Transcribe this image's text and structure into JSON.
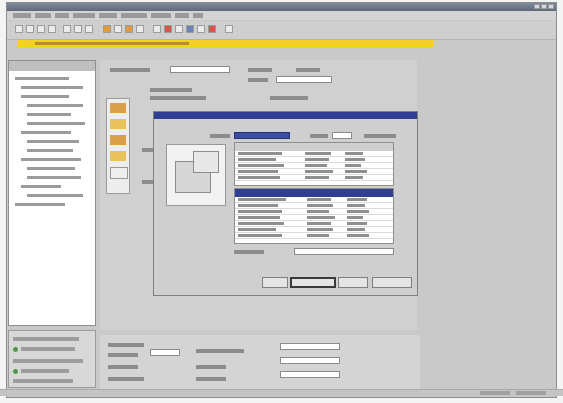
{
  "app": {
    "title": ""
  },
  "menu": [
    {
      "label": ""
    },
    {
      "label": ""
    },
    {
      "label": ""
    },
    {
      "label": ""
    },
    {
      "label": ""
    },
    {
      "label": ""
    },
    {
      "label": ""
    },
    {
      "label": ""
    },
    {
      "label": ""
    }
  ],
  "toolbar": {
    "icons": [
      "new-icon",
      "open-icon",
      "save-icon",
      "print-icon",
      "cut-icon",
      "copy-icon",
      "paste-icon",
      "undo-icon",
      "redo-icon",
      "tool-icon",
      "tool-icon",
      "tool-icon",
      "tool-icon",
      "tool-icon",
      "tool-icon",
      "tool-icon",
      "tool-icon",
      "help-icon"
    ]
  },
  "dialog": {
    "title": "",
    "buttons": [
      {
        "label": ""
      },
      {
        "label": ""
      },
      {
        "label": ""
      },
      {
        "label": ""
      }
    ]
  }
}
